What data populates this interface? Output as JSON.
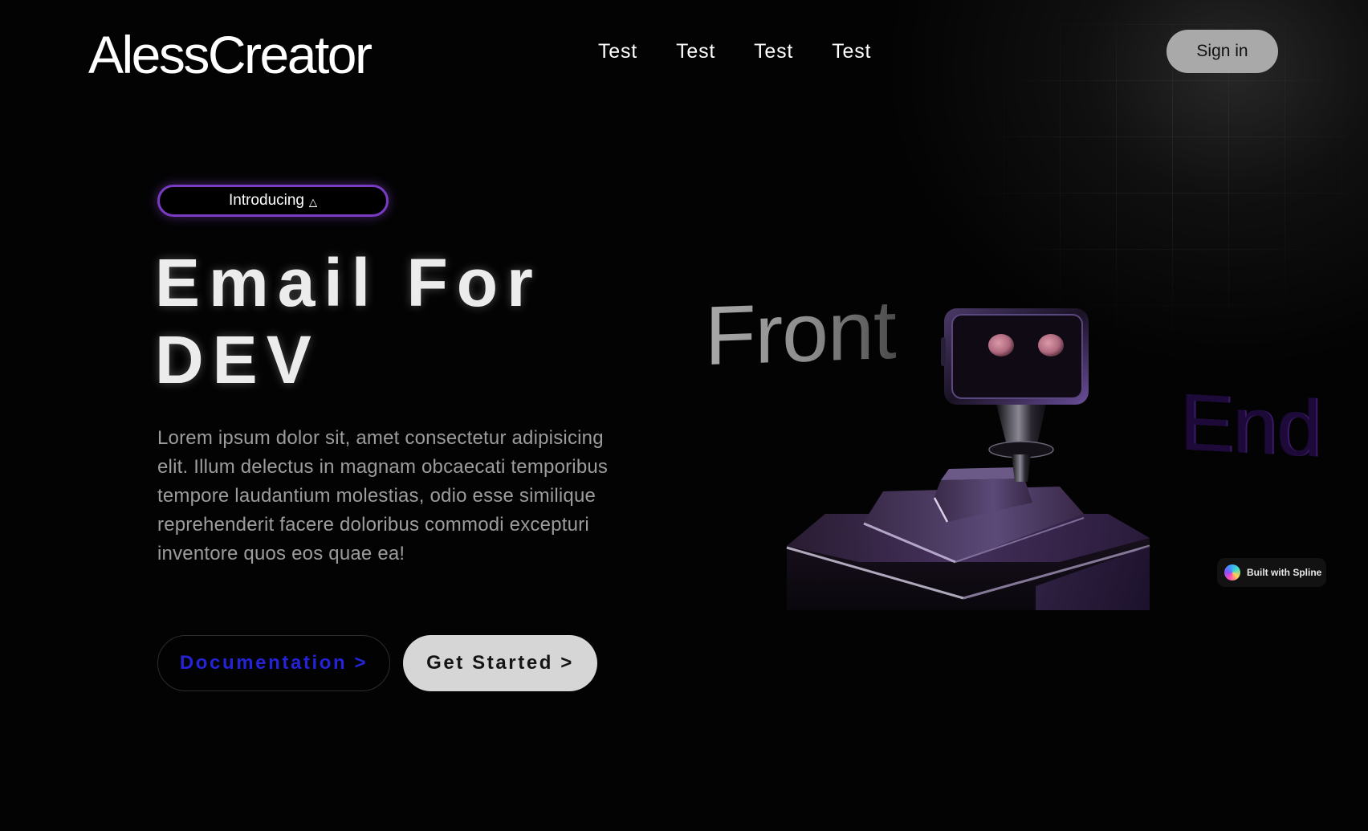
{
  "header": {
    "logo": "AlessCreator",
    "nav": [
      "Test",
      "Test",
      "Test",
      "Test"
    ],
    "signin_label": "Sign in"
  },
  "hero": {
    "badge_text": "Introducing",
    "badge_icon": "△",
    "headline_line1": "Email For",
    "headline_line2": "DEV",
    "description": "Lorem ipsum dolor sit, amet consectetur adipisicing elit. Illum delectus in magnam obcaecati temporibus tempore laudantium molestias, odio esse similique reprehenderit facere doloribus commodi excepturi inventore quos eos quae ea!",
    "doc_button": "Documentation >",
    "start_button": "Get Started >"
  },
  "scene": {
    "front_word": "Front",
    "end_word": "End",
    "spline_badge": "Built with Spline"
  },
  "colors": {
    "background": "#030303",
    "badge_border": "#7a3bc4",
    "doc_text": "#2424d6",
    "signin_bg": "#a9a9a9",
    "start_bg": "#d6d6d6",
    "robot_purple": "#2a1840"
  },
  "icons": {
    "badge": "triangle-icon",
    "spline": "spline-logo-icon"
  }
}
